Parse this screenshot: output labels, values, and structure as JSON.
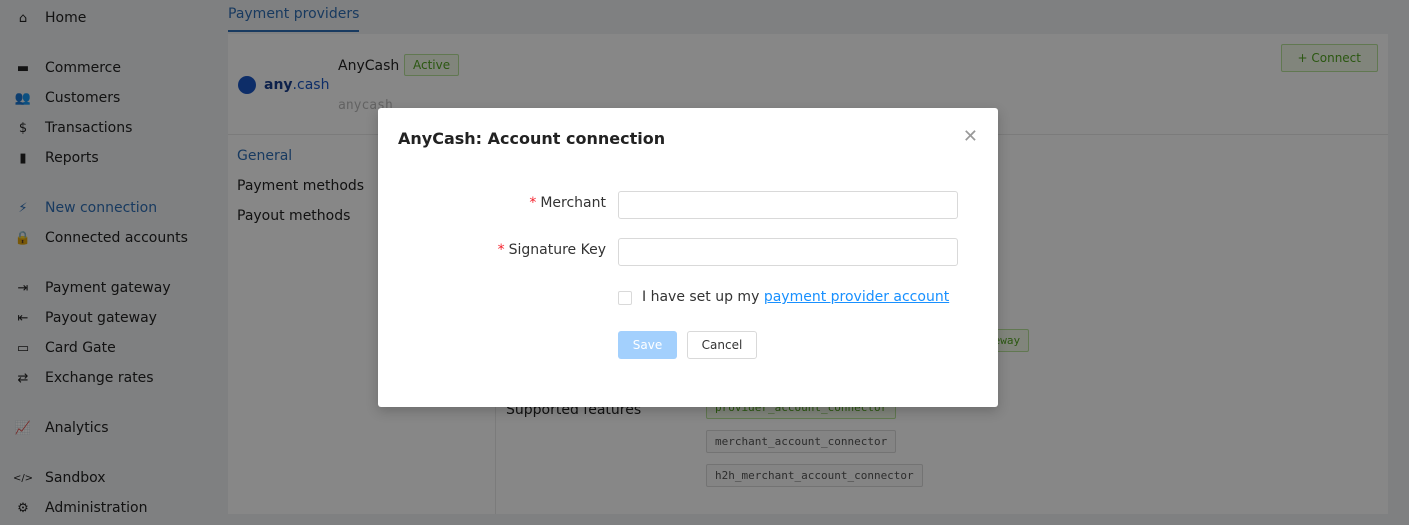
{
  "sidebar": {
    "items": [
      {
        "label": "Home",
        "icon": "home-icon",
        "glyph": "⌂"
      },
      {
        "label": "Commerce",
        "icon": "store-icon",
        "glyph": "▬"
      },
      {
        "label": "Customers",
        "icon": "users-icon",
        "glyph": "👥"
      },
      {
        "label": "Transactions",
        "icon": "dollar-icon",
        "glyph": "$"
      },
      {
        "label": "Reports",
        "icon": "file-download-icon",
        "glyph": "▮"
      },
      {
        "label": "New connection",
        "icon": "plug-icon",
        "glyph": "⚡"
      },
      {
        "label": "Connected accounts",
        "icon": "lock-icon",
        "glyph": "🔒"
      },
      {
        "label": "Payment gateway",
        "icon": "sign-in-icon",
        "glyph": "⇥"
      },
      {
        "label": "Payout gateway",
        "icon": "sign-out-icon",
        "glyph": "⇤"
      },
      {
        "label": "Card Gate",
        "icon": "credit-card-icon",
        "glyph": "▭"
      },
      {
        "label": "Exchange rates",
        "icon": "exchange-icon",
        "glyph": "⇄"
      },
      {
        "label": "Analytics",
        "icon": "chart-line-icon",
        "glyph": "📈"
      },
      {
        "label": "Sandbox",
        "icon": "code-icon",
        "glyph": "</>"
      },
      {
        "label": "Administration",
        "icon": "gear-icon",
        "glyph": "⚙"
      }
    ],
    "active": "New connection"
  },
  "main": {
    "tab": "Payment providers",
    "logo": {
      "bold": "any",
      "rest": ".cash"
    },
    "provider_name": "AnyCash",
    "status": "Active",
    "slug": "anycash",
    "connect_label": "+ Connect",
    "subnav": [
      "General",
      "Payment methods",
      "Payout methods"
    ],
    "gateway_tag_partial": "teway",
    "supported_features_label": "Supported features",
    "features": [
      "provider_account_connector",
      "merchant_account_connector",
      "h2h_merchant_account_connector"
    ]
  },
  "modal": {
    "title": "AnyCash: Account connection",
    "merchant_label": "Merchant",
    "signature_label": "Signature Key",
    "merchant_value": "",
    "signature_value": "",
    "checkbox_text": "I have set up my ",
    "checkbox_link": "payment provider account",
    "save": "Save",
    "cancel": "Cancel"
  }
}
